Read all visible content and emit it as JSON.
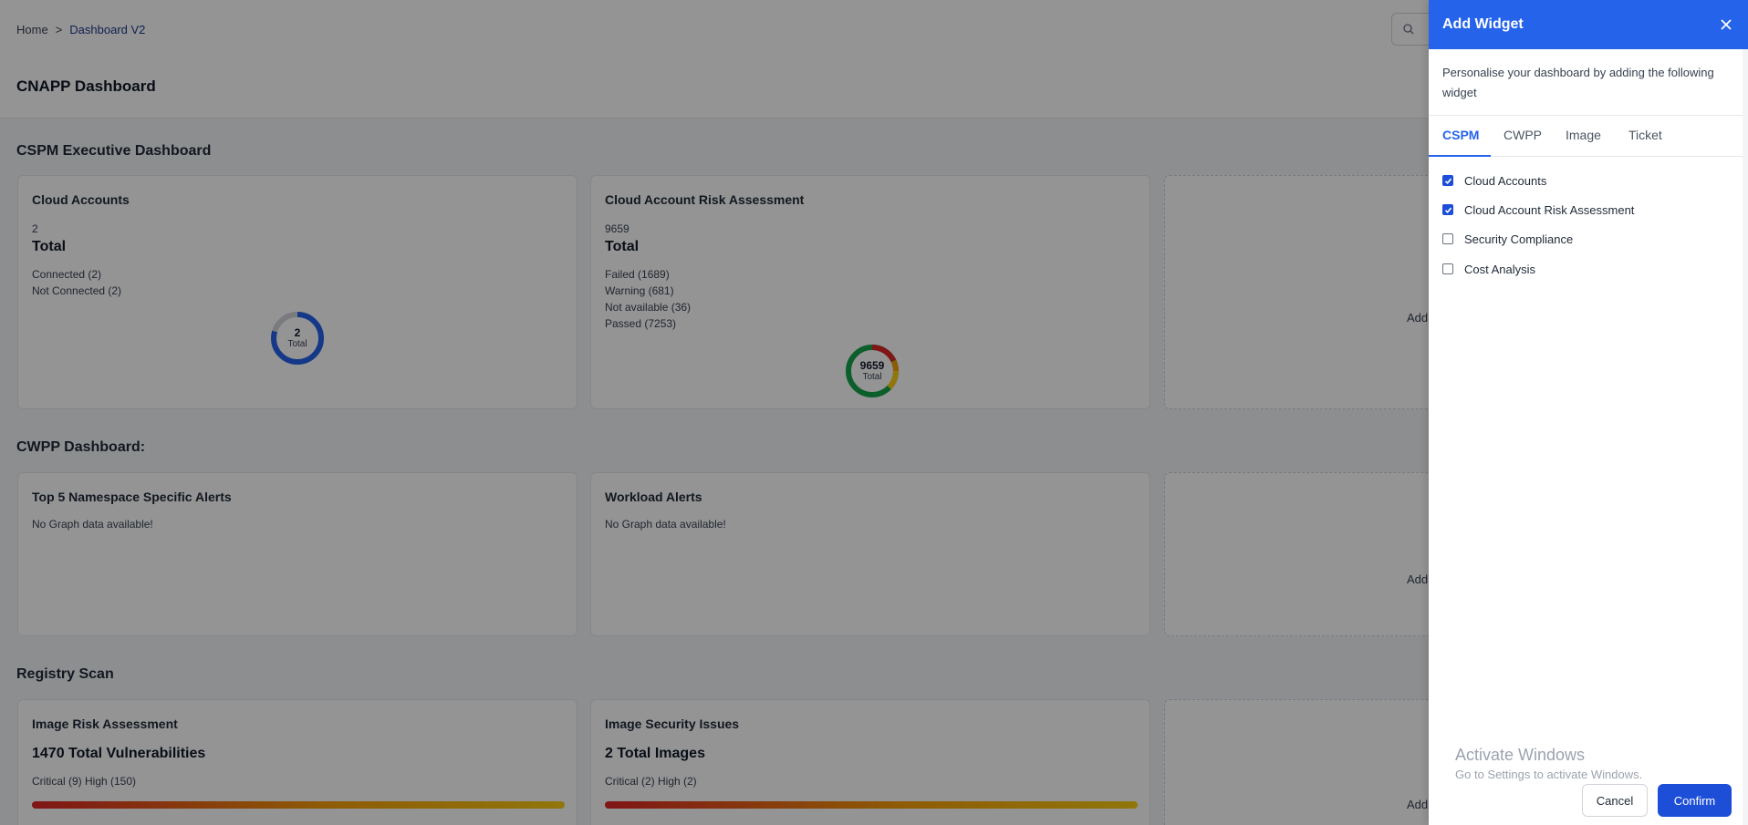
{
  "breadcrumb": {
    "home": "Home",
    "separator": ">",
    "current": "Dashboard V2"
  },
  "page_title": "CNAPP Dashboard",
  "sections": {
    "cspm": {
      "title": "CSPM Executive Dashboard",
      "cloud_accounts": {
        "title": "Cloud Accounts",
        "count": "2",
        "total_label": "Total",
        "legend": [
          "Connected (2)",
          "Not Connected (2)"
        ],
        "donut_number": "2",
        "donut_label": "Total"
      },
      "risk_assessment": {
        "title": "Cloud Account Risk Assessment",
        "count": "9659",
        "total_label": "Total",
        "legend": [
          "Failed (1689)",
          "Warning (681)",
          "Not available (36)",
          "Passed (7253)"
        ],
        "donut_number": "9659",
        "donut_label": "Total"
      },
      "add_label": "Add"
    },
    "cwpp": {
      "title": "CWPP Dashboard:",
      "namespace_alerts": {
        "title": "Top 5 Namespace Specific Alerts",
        "empty": "No Graph data available!"
      },
      "workload_alerts": {
        "title": "Workload Alerts",
        "empty": "No Graph data available!"
      },
      "add_label": "Add"
    },
    "registry": {
      "title": "Registry Scan",
      "image_risk": {
        "title": "Image Risk Assessment",
        "stat": "1470 Total Vulnerabilities",
        "severity": "Critical (9) High (150)"
      },
      "image_security": {
        "title": "Image Security Issues",
        "stat": "2 Total Images",
        "severity": "Critical (2) High (2)"
      },
      "add_label": "Add"
    }
  },
  "drawer": {
    "title": "Add Widget",
    "description": "Personalise your dashboard by adding the following widget",
    "tabs": [
      "CSPM",
      "CWPP",
      "Image",
      "Ticket"
    ],
    "active_tab": "CSPM",
    "options": [
      {
        "label": "Cloud Accounts",
        "checked": true
      },
      {
        "label": "Cloud Account Risk Assessment",
        "checked": true
      },
      {
        "label": "Security Compliance",
        "checked": false
      },
      {
        "label": "Cost Analysis",
        "checked": false
      }
    ],
    "cancel_label": "Cancel",
    "confirm_label": "Confirm"
  },
  "watermark": {
    "line1": "Activate Windows",
    "line2": "Go to Settings to activate Windows."
  },
  "colors": {
    "accent": "#2563eb",
    "donut_connected": "#2563eb",
    "donut_not_connected": "#d1d5db",
    "risk_failed": "#dc2626",
    "risk_warning": "#f59e0b",
    "risk_not_available": "#9ca3af",
    "risk_passed": "#16a34a"
  },
  "icons": {
    "search": "search-icon",
    "close": "close-icon",
    "checkbox": "checkbox-icon"
  }
}
